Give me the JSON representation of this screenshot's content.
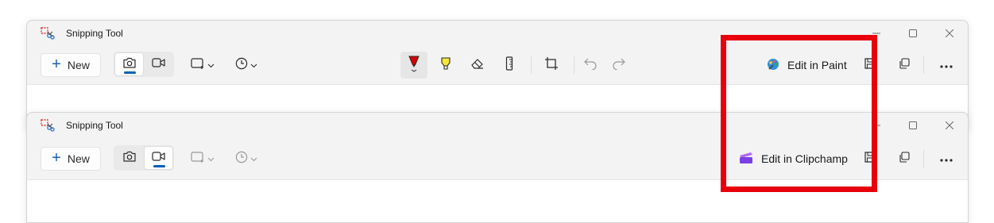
{
  "windows": [
    {
      "title": "Snipping Tool",
      "new_label": "New",
      "capture_mode": "screenshot",
      "edit_app_label": "Edit in Paint"
    },
    {
      "title": "Snipping Tool",
      "new_label": "New",
      "capture_mode": "video",
      "edit_app_label": "Edit in Clipchamp"
    }
  ],
  "colors": {
    "accent": "#005fb8",
    "highlight_box": "#e8000b",
    "pen_red": "#d40000",
    "highlighter_yellow": "#f5e63a",
    "clipchamp_purple": "#7b3fe4"
  },
  "icons": [
    "snipping-tool-icon",
    "plus-icon",
    "camera-icon",
    "video-icon",
    "snip-mode-icon",
    "timer-icon",
    "ballpoint-pen-icon",
    "highlighter-icon",
    "eraser-icon",
    "ruler-icon",
    "crop-icon",
    "undo-icon",
    "redo-icon",
    "paint-icon",
    "clipchamp-icon",
    "save-icon",
    "copy-icon",
    "more-icon",
    "minimize-icon",
    "maximize-icon",
    "close-icon"
  ]
}
